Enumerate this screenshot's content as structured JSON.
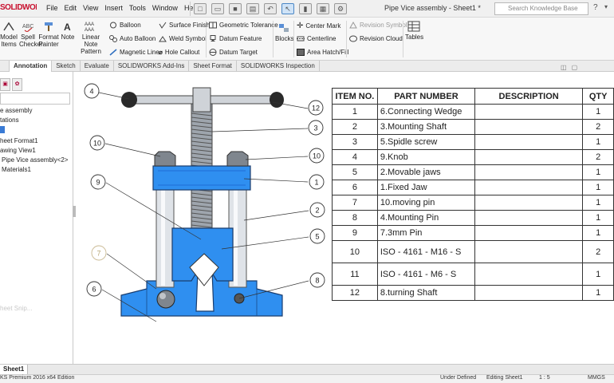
{
  "app": {
    "logo": "SOLIDWORKS",
    "menus": [
      "File",
      "Edit",
      "View",
      "Insert",
      "Tools",
      "Window",
      "Help"
    ],
    "title": "Pipe Vice assembly - Sheet1 *",
    "search_placeholder": "Search Knowledge Base"
  },
  "ribbon": {
    "model_items": "Model Items",
    "spell_checker": "Spell Checker",
    "format_painter": "Format Painter",
    "note": "Note",
    "linear_note_pattern": "Linear Note Pattern",
    "balloon": "Balloon",
    "auto_balloon": "Auto Balloon",
    "magnetic_line": "Magnetic Line",
    "surface_finish": "Surface Finish",
    "weld_symbol": "Weld Symbol",
    "hole_callout": "Hole Callout",
    "geometric_tolerance": "Geometric Tolerance",
    "datum_feature": "Datum Feature",
    "datum_target": "Datum Target",
    "blocks": "Blocks",
    "center_mark": "Center Mark",
    "centerline": "Centerline",
    "area_hatch": "Area Hatch/Fill",
    "revision_symbol": "Revision Symbol",
    "revision_cloud": "Revision Cloud",
    "tables": "Tables"
  },
  "tabs": [
    "Annotation",
    "Sketch",
    "Evaluate",
    "SOLIDWORKS Add-Ins",
    "Sheet Format",
    "SOLIDWORKS Inspection"
  ],
  "tabs_active": "Annotation",
  "tree": {
    "items": [
      "e assembly",
      "tations",
      "",
      "heet Format1",
      "awing View1",
      "Pipe Vice assembly<2>",
      "Materials1"
    ],
    "ghost": "heet Snip..."
  },
  "balloons": [
    "4",
    "12",
    "3",
    "10",
    "10",
    "9",
    "1",
    "2",
    "5",
    "7",
    "8",
    "6"
  ],
  "bom": {
    "headers": [
      "ITEM NO.",
      "PART NUMBER",
      "DESCRIPTION",
      "QTY"
    ],
    "rows": [
      {
        "item": "1",
        "part": "6.Connecting Wedge",
        "desc": "",
        "qty": "1"
      },
      {
        "item": "2",
        "part": "3.Mounting Shaft",
        "desc": "",
        "qty": "2"
      },
      {
        "item": "3",
        "part": "5.Spidle screw",
        "desc": "",
        "qty": "1"
      },
      {
        "item": "4",
        "part": "9.Knob",
        "desc": "",
        "qty": "2"
      },
      {
        "item": "5",
        "part": "2.Movable jaws",
        "desc": "",
        "qty": "1"
      },
      {
        "item": "6",
        "part": "1.Fixed Jaw",
        "desc": "",
        "qty": "1"
      },
      {
        "item": "7",
        "part": "10.moving pin",
        "desc": "",
        "qty": "1"
      },
      {
        "item": "8",
        "part": "4.Mounting Pin",
        "desc": "",
        "qty": "1"
      },
      {
        "item": "9",
        "part": "7.3mm Pin",
        "desc": "",
        "qty": "1"
      },
      {
        "item": "10",
        "part": "ISO - 4161 - M16 - S",
        "desc": "",
        "qty": "2"
      },
      {
        "item": "11",
        "part": "ISO - 4161 - M6 - S",
        "desc": "",
        "qty": "1"
      },
      {
        "item": "12",
        "part": "8.turning Shaft",
        "desc": "",
        "qty": "1"
      }
    ]
  },
  "sheet_tab": "Sheet1",
  "status": {
    "edition": "KS Premium 2016 x64 Edition",
    "state": "Under Defined",
    "editing": "Editing Sheet1",
    "scale": "1 : 5",
    "units": "MMGS"
  },
  "colors": {
    "part_blue": "#2f8ff0",
    "accent": "#3a7bd5"
  }
}
